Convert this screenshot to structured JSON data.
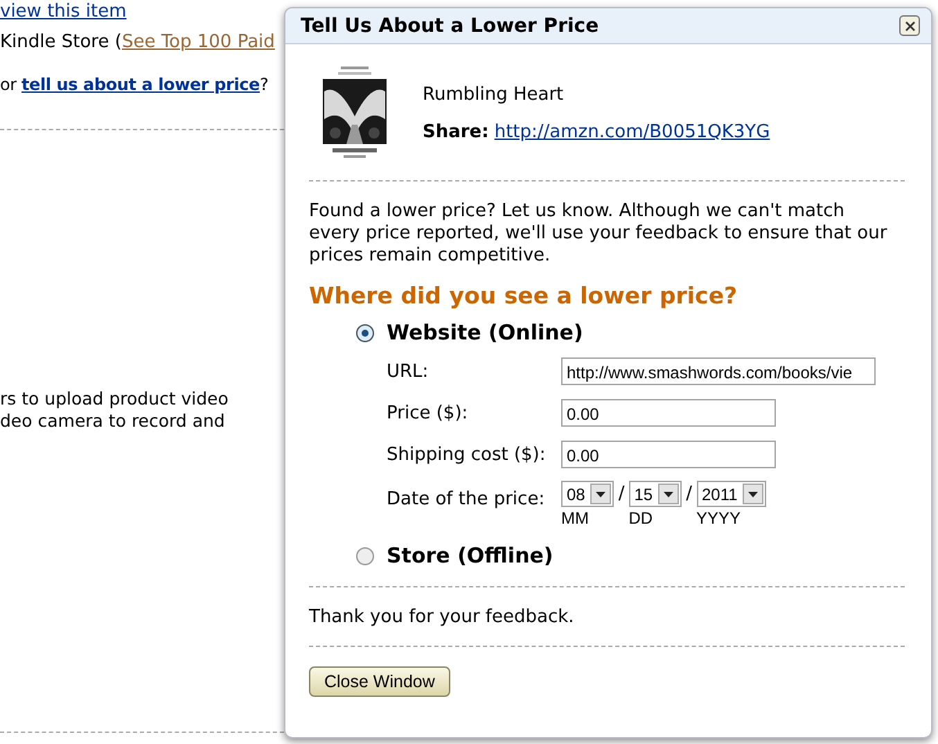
{
  "page": {
    "review_link": "view this item",
    "store_text": "Kindle Store (",
    "top100_link": "See Top 100 Paid",
    "or_text": "or",
    "lower_price_link": "tell us about a lower price",
    "question_mark": "?",
    "video_lines": [
      "rs to upload product video",
      "deo camera to record and"
    ]
  },
  "dialog": {
    "title": "Tell Us About a Lower Price",
    "product": {
      "title": "Rumbling Heart",
      "share_label": "Share:",
      "share_link": "http://amzn.com/B0051QK3YG"
    },
    "intro": "Found a lower price? Let us know. Although we can't match every price reported, we'll use your feedback to ensure that our prices remain competitive.",
    "question": "Where did you see a lower price?",
    "options": [
      {
        "label": "Website (Online)",
        "selected": true
      },
      {
        "label": "Store (Offline)",
        "selected": false
      }
    ],
    "fields": [
      {
        "label": "URL:",
        "value": "http://www.smashwords.com/books/vie"
      },
      {
        "label": "Price ($):",
        "value": "0.00"
      },
      {
        "label": "Shipping cost ($):",
        "value": "0.00"
      }
    ],
    "date": {
      "label": "Date of the price:",
      "parts": [
        {
          "value": "08",
          "caption": "MM",
          "separator": "/"
        },
        {
          "value": "15",
          "caption": "DD",
          "separator": "/"
        },
        {
          "value": "2011",
          "caption": "YYYY"
        }
      ]
    },
    "thanks": "Thank you for your feedback.",
    "close_button": "Close Window"
  }
}
